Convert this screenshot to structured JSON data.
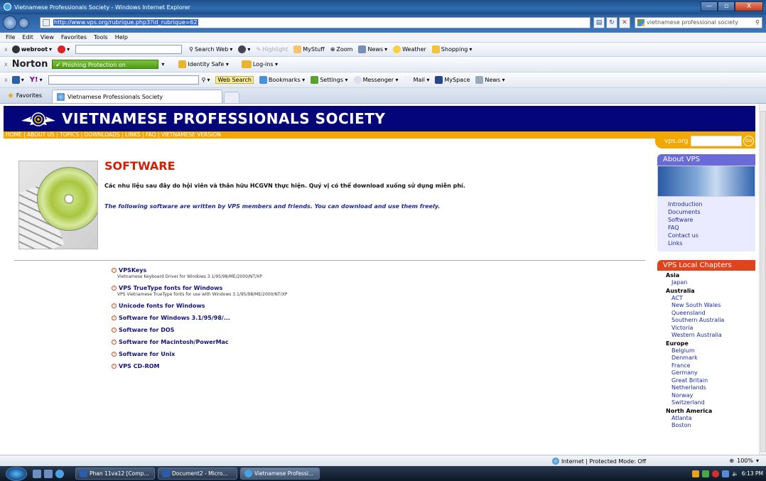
{
  "window": {
    "title": "Vietnamese Professionals Society - Windows Internet Explorer",
    "minimize": "—",
    "maximize": "▫",
    "close": "X"
  },
  "address": {
    "url": "http://www.vps.org/rubrique.php3?id_rubrique=62",
    "search_value": "vietnamese professional society"
  },
  "menu": [
    "File",
    "Edit",
    "View",
    "Favorites",
    "Tools",
    "Help"
  ],
  "toolbar1": {
    "brand": "webroot",
    "search_web": "Search Web",
    "highlight": "Highlight",
    "mystuff": "MyStuff",
    "zoom": "Zoom",
    "news": "News",
    "weather": "Weather",
    "shopping": "Shopping"
  },
  "toolbar2": {
    "brand": "Norton",
    "phishing": "Phishing Protection on",
    "identity_safe": "Identity Safe ▾",
    "logins": "Log-ins ▾"
  },
  "toolbar3": {
    "web_search": "Web Search",
    "bookmarks": "Bookmarks ▾",
    "settings": "Settings ▾",
    "messenger": "Messenger ▾",
    "mail": "Mail ▾",
    "myspace": "MySpace",
    "news": "News ▾"
  },
  "tabs": {
    "favorites": "Favorites",
    "active_tab": "Vietnamese Professionals Society"
  },
  "site": {
    "title": "VIETNAMESE PROFESSIONALS SOCIETY",
    "nav": [
      "HOME",
      "ABOUT US",
      "TOPICS",
      "DOWNLOADS",
      "LINKS",
      "FAQ",
      "VIETNAMESE VERSION"
    ],
    "search_label": "vps.org",
    "search_go": "Go"
  },
  "main": {
    "heading": "SOFTWARE",
    "vn_text": "Các nhu liệu sau đây do hội viên và thân hữu HCGVN thực hiện. Quý vị có thể download xuống sử dụng miễn phí.",
    "en_text": "The following software are written by VPS members and friends. You can download and use them freely.",
    "items": [
      {
        "title": "VPSKeys",
        "desc": "Vietnamese Keyboard Driver for Windows 3.1/95/98/ME/2000/NT/XP"
      },
      {
        "title": "VPS TrueType fonts for Windows",
        "desc": "VPS Vietnamese TrueType fonts for use with Windows 3.1/95/98/ME/2000/NT/XP"
      },
      {
        "title": "Unicode fonts for Windows",
        "desc": ""
      },
      {
        "title": "Software for Windows 3.1/95/98/...",
        "desc": ""
      },
      {
        "title": "Software for DOS",
        "desc": ""
      },
      {
        "title": "Software for Macintosh/PowerMac",
        "desc": ""
      },
      {
        "title": "Software for Unix",
        "desc": ""
      },
      {
        "title": "VPS CD-ROM",
        "desc": ""
      }
    ]
  },
  "sidebar": {
    "about_heading": "About VPS",
    "about_links": [
      "Introduction",
      "Documents",
      "Software",
      "FAQ",
      "Contact us",
      "Links"
    ],
    "chapters_heading": "VPS Local Chapters",
    "regions": [
      {
        "name": "Asia",
        "chapters": [
          "Japan"
        ]
      },
      {
        "name": "Australia",
        "chapters": [
          "ACT",
          "New South Wales",
          "Queensland",
          "Southern Australia",
          "Victoria",
          "Western Australia"
        ]
      },
      {
        "name": "Europe",
        "chapters": [
          "Belgium",
          "Denmark",
          "France",
          "Germany",
          "Great Britain",
          "Netherlands",
          "Norway",
          "Switzerland"
        ]
      },
      {
        "name": "North America",
        "chapters": [
          "Atlanta",
          "Boston"
        ]
      }
    ]
  },
  "status": {
    "zone": "Internet | Protected Mode: Off",
    "zoom": "100%"
  },
  "taskbar": {
    "buttons": [
      "Phan 11va12 [Comp...",
      "Document2 - Micro...",
      "Vietnamese Professi..."
    ],
    "clock": "6:13 PM"
  },
  "colors": {
    "site_header": "#05057a",
    "nav_strip": "#f2a800",
    "heading": "#d11f05",
    "chapters_header": "#e0441d",
    "about_header": "#6a6ad8"
  }
}
